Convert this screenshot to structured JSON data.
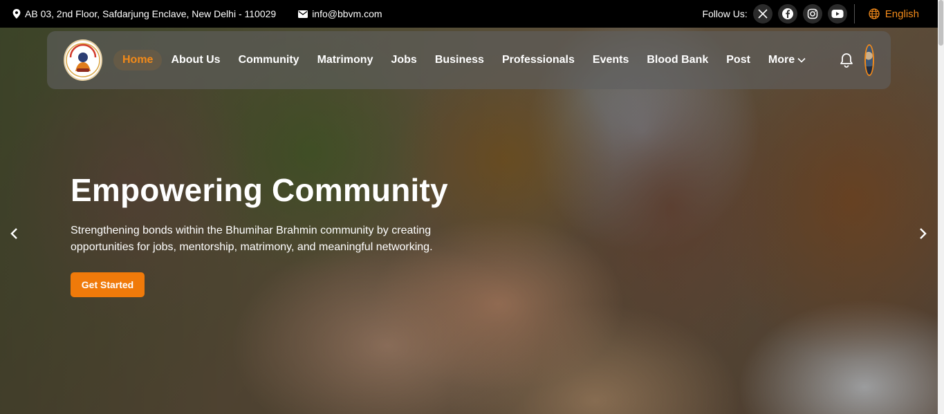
{
  "topbar": {
    "address": "AB 03, 2nd Floor, Safdarjung Enclave, New Delhi - 110029",
    "email": "info@bbvm.com",
    "follow_label": "Follow Us:",
    "socials": [
      "x-icon",
      "facebook-icon",
      "instagram-icon",
      "youtube-icon"
    ],
    "language": "English"
  },
  "nav": {
    "items": [
      "Home",
      "About Us",
      "Community",
      "Matrimony",
      "Jobs",
      "Business",
      "Professionals",
      "Events",
      "Blood Bank",
      "Post",
      "More"
    ],
    "active": "Home"
  },
  "hero": {
    "title": "Empowering Community",
    "subtitle": "Strengthening bonds within the Bhumihar Brahmin community by creating opportunities for jobs, mentorship, matrimony, and meaningful networking.",
    "cta": "Get Started"
  },
  "colors": {
    "accent": "#f28a1a",
    "button": "#f07a0a",
    "topbar": "#000000"
  }
}
